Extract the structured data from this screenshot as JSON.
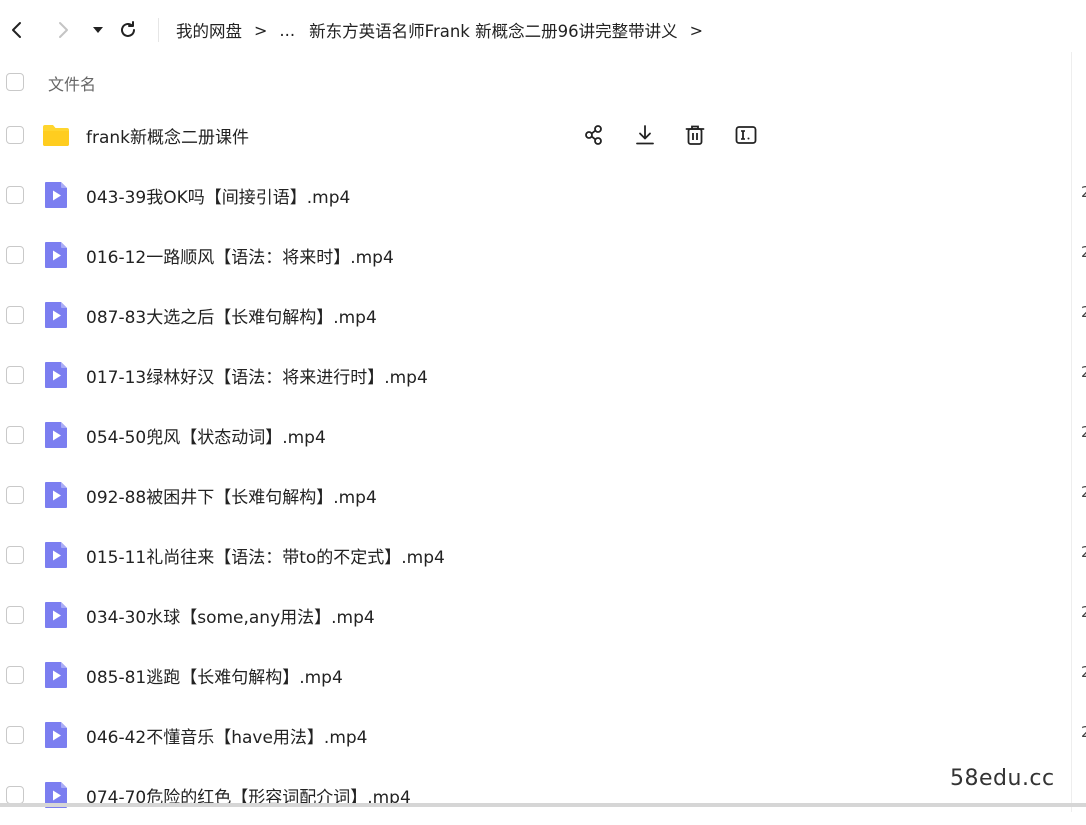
{
  "nav": {
    "back_icon": "chevron-left-icon",
    "forward_icon": "chevron-right-icon",
    "history_icon": "caret-down-icon",
    "refresh_icon": "refresh-icon"
  },
  "breadcrumb": {
    "root": "我的网盘",
    "ellipsis": "...",
    "current": "新东方英语名师Frank 新概念二册96讲完整带讲义",
    "sep": ">"
  },
  "list_header": {
    "name_label": "文件名"
  },
  "folder": {
    "name": "frank新概念二册课件",
    "icon": "folder-icon",
    "color": "#ffd52e",
    "actions": [
      "share-icon",
      "download-icon",
      "delete-icon",
      "rename-icon"
    ]
  },
  "files": [
    {
      "name": "043-39我OK吗【间接引语】.mp4"
    },
    {
      "name": "016-12一路顺风【语法：将来时】.mp4"
    },
    {
      "name": "087-83大选之后【长难句解构】.mp4"
    },
    {
      "name": "017-13绿林好汉【语法：将来进行时】.mp4"
    },
    {
      "name": "054-50兜风【状态动词】.mp4"
    },
    {
      "name": "092-88被困井下【长难句解构】.mp4"
    },
    {
      "name": "015-11礼尚往来【语法：带to的不定式】.mp4"
    },
    {
      "name": "034-30水球【some,any用法】.mp4"
    },
    {
      "name": "085-81逃跑【长难句解构】.mp4"
    },
    {
      "name": "046-42不懂音乐【have用法】.mp4"
    },
    {
      "name": "074-70危险的红色【形容词配介词】.mp4"
    }
  ],
  "file_icon": "video-file-icon",
  "video_icon_color": "#7b7ef0",
  "edge_digit": "2",
  "watermark": "58edu.cc"
}
